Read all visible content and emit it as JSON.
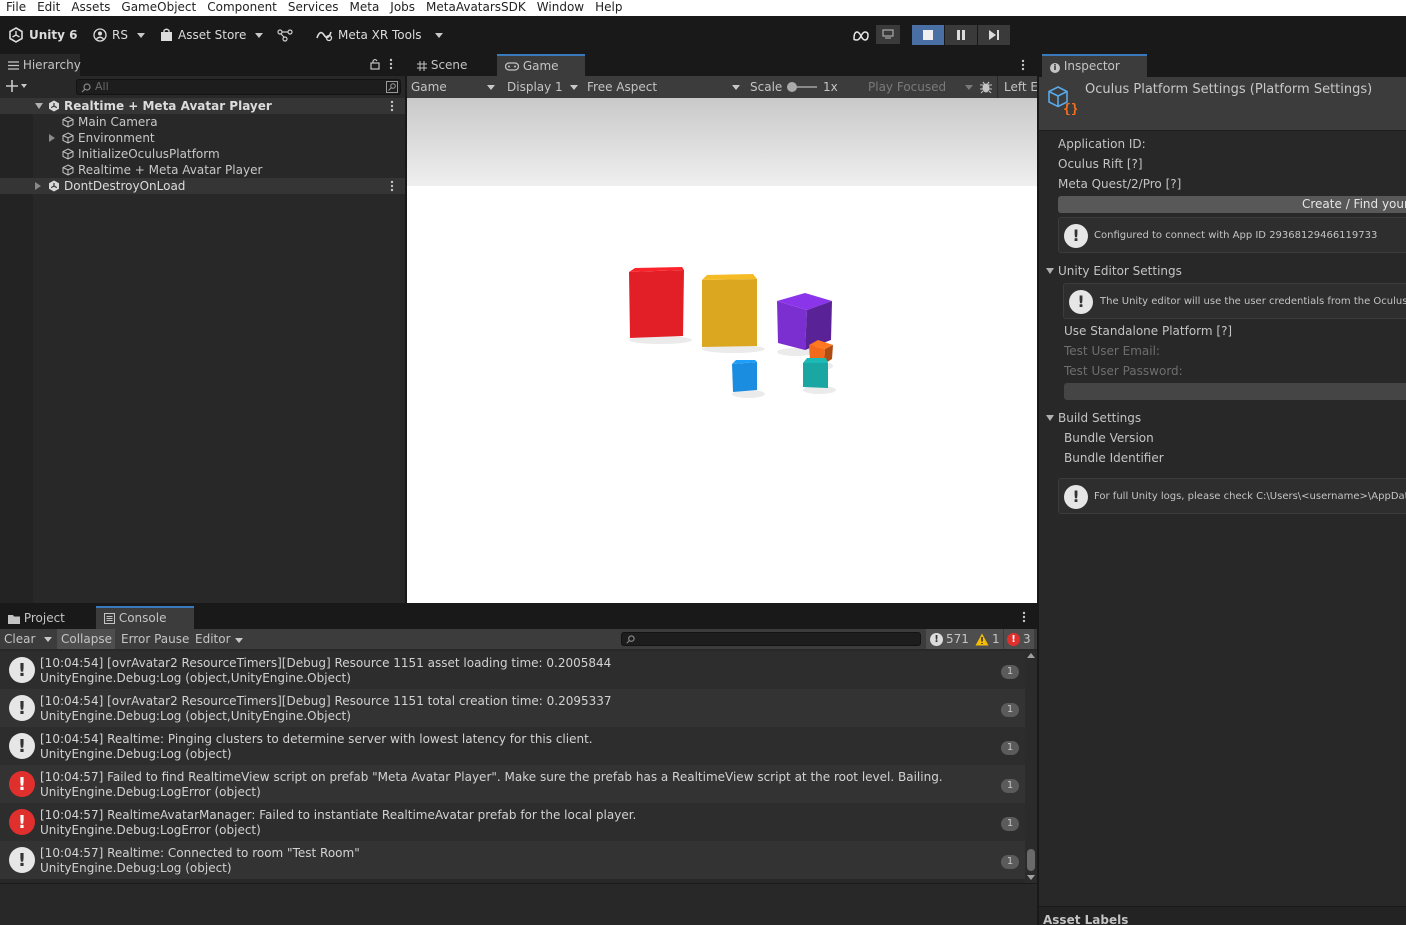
{
  "menu": [
    "File",
    "Edit",
    "Assets",
    "GameObject",
    "Component",
    "Services",
    "Meta",
    "Jobs",
    "MetaAvatarsSDK",
    "Window",
    "Help"
  ],
  "toolbar": {
    "unity_label": "Unity 6",
    "account_label": "RS",
    "asset_store_label": "Asset Store",
    "meta_xr_label": "Meta XR Tools"
  },
  "hierarchy": {
    "tab_label": "Hierarchy",
    "search_placeholder": "All",
    "rows": [
      {
        "label": "Realtime + Meta Avatar Player",
        "level": 0,
        "expanded": true,
        "scene": true
      },
      {
        "label": "Main Camera",
        "level": 1
      },
      {
        "label": "Environment",
        "level": 1,
        "has_children": true
      },
      {
        "label": "InitializeOculusPlatform",
        "level": 1
      },
      {
        "label": "Realtime + Meta Avatar Player",
        "level": 1
      },
      {
        "label": "DontDestroyOnLoad",
        "level": 0,
        "scene": true
      }
    ]
  },
  "game": {
    "tabs": [
      "Scene",
      "Game"
    ],
    "active_tab": "Game",
    "game_dropdown": "Game",
    "display_dropdown": "Display 1",
    "aspect_dropdown": "Free Aspect",
    "scale_label": "Scale",
    "scale_value": "1x",
    "play_focused_label": "Play Focused",
    "left_eye_label": "Left E",
    "cubes": [
      {
        "name": "red-cube",
        "color": "#e21f26"
      },
      {
        "name": "yellow-cube",
        "color": "#dba721"
      },
      {
        "name": "purple-cube",
        "color": "#7b2fd1"
      },
      {
        "name": "blue-cube",
        "color": "#1b8de0"
      },
      {
        "name": "orange-cube",
        "color": "#f36a1b"
      },
      {
        "name": "teal-cube",
        "color": "#1aa6a2"
      }
    ]
  },
  "console": {
    "tabs": [
      "Project",
      "Console"
    ],
    "active_tab": "Console",
    "buttons": {
      "clear": "Clear",
      "collapse": "Collapse",
      "error_pause": "Error Pause",
      "editor": "Editor"
    },
    "counts": {
      "log": "571",
      "warning": "1",
      "error": "3"
    },
    "entries": [
      {
        "type": "log",
        "line1": "[10:04:54] [ovrAvatar2 ResourceTimers][Debug] Resource 1151 asset loading time: 0.2005844",
        "line2": "UnityEngine.Debug:Log (object,UnityEngine.Object)",
        "count": "1"
      },
      {
        "type": "log",
        "line1": "[10:04:54] [ovrAvatar2 ResourceTimers][Debug] Resource 1151 total creation time: 0.2095337",
        "line2": "UnityEngine.Debug:Log (object,UnityEngine.Object)",
        "count": "1"
      },
      {
        "type": "log",
        "line1": "[10:04:54] Realtime: Pinging clusters to determine server with lowest latency for this client.",
        "line2": "UnityEngine.Debug:Log (object)",
        "count": "1"
      },
      {
        "type": "error",
        "line1": "[10:04:57] Failed to find RealtimeView script on prefab \"Meta Avatar Player\". Make sure the prefab has a RealtimeView script at the root level. Bailing.",
        "line2": "UnityEngine.Debug:LogError (object)",
        "count": "1"
      },
      {
        "type": "error",
        "line1": "[10:04:57] RealtimeAvatarManager: Failed to instantiate RealtimeAvatar prefab for the local player.",
        "line2": "UnityEngine.Debug:LogError (object)",
        "count": "1"
      },
      {
        "type": "log",
        "line1": "[10:04:57] Realtime: Connected to room \"Test Room\"",
        "line2": "UnityEngine.Debug:Log (object)",
        "count": "1"
      }
    ]
  },
  "inspector": {
    "tab_label": "Inspector",
    "title": "Oculus Platform Settings (Platform Settings)",
    "application_id_label": "Application ID:",
    "oculus_rift_label": "Oculus Rift [?]",
    "meta_quest_label": "Meta Quest/2/Pro [?]",
    "create_find_button": "Create / Find your",
    "help_configured": "Configured to connect with App ID 29368129466119733",
    "editor_section": "Unity Editor Settings",
    "help_editor": "The Unity editor will use the user credentials from the Oculus app",
    "use_standalone_label": "Use Standalone Platform [?]",
    "test_email_label": "Test User Email:",
    "test_password_label": "Test User Password:",
    "build_section": "Build Settings",
    "bundle_version_label": "Bundle Version",
    "bundle_identifier_label": "Bundle Identifier",
    "help_logs": "For full Unity logs, please check C:\\Users\\<username>\\AppData\\L",
    "asset_labels": "Asset Labels"
  }
}
